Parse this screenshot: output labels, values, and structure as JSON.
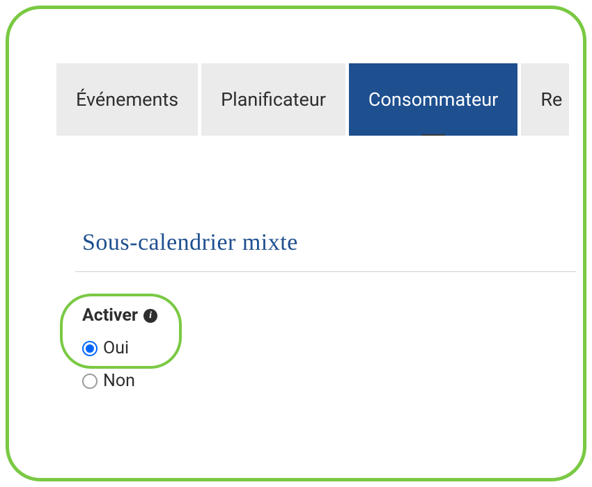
{
  "tabs": [
    {
      "label": "Événements",
      "active": false
    },
    {
      "label": "Planificateur",
      "active": false
    },
    {
      "label": "Consommateur",
      "active": true
    },
    {
      "label": "Re",
      "active": false
    }
  ],
  "section": {
    "title": "Sous-calendrier mixte"
  },
  "field": {
    "label": "Activer",
    "options": {
      "yes": "Oui",
      "no": "Non"
    },
    "selected": "yes"
  }
}
